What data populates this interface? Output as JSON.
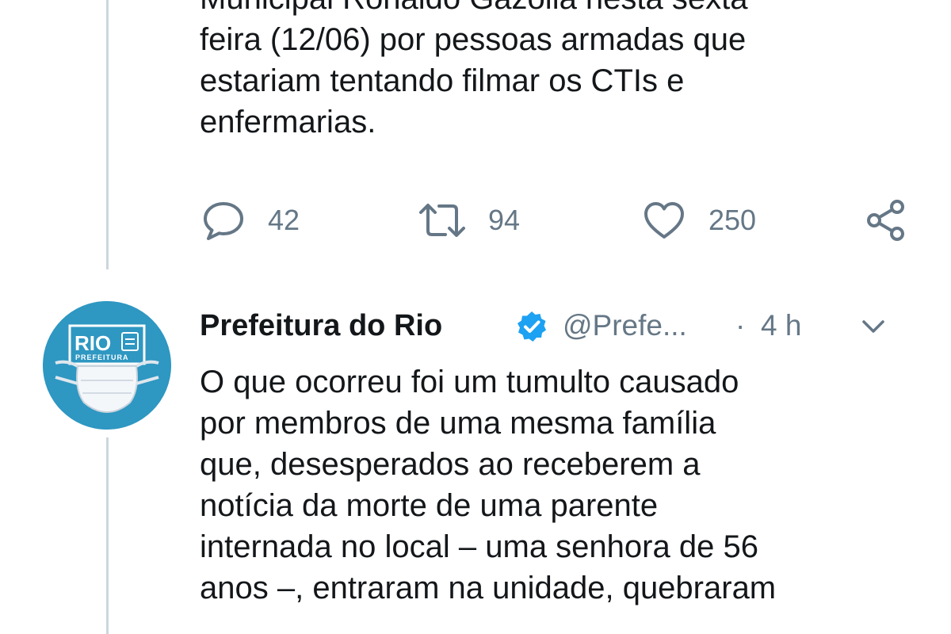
{
  "tweet_above": {
    "text_lines": [
      "Municipal Ronaldo Gazolla nesta sexta",
      "feira (12/06) por pessoas armadas que",
      "estariam tentando filmar os CTIs e",
      "enfermarias."
    ],
    "actions": {
      "replies": "42",
      "retweets": "94",
      "likes": "250"
    }
  },
  "tweet": {
    "author_name": "Prefeitura do Rio",
    "handle": "@Prefe...",
    "separator": "·",
    "time": "4 h",
    "avatar": {
      "text_main": "RIO",
      "text_sub": "PREFEITURA",
      "color": "#2e97c2"
    },
    "text_lines": [
      "O que ocorreu foi um tumulto causado",
      "por membros de uma mesma família",
      "que, desesperados ao receberem a",
      "notícia da morte de uma parente",
      "internada no local – uma senhora de 56",
      "anos –, entraram na unidade, quebraram"
    ]
  },
  "icons": {
    "reply": "reply-icon",
    "retweet": "retweet-icon",
    "like": "heart-icon",
    "share": "share-icon",
    "verified": "verified-badge-icon",
    "more": "chevron-down-icon"
  },
  "colors": {
    "text": "#14171a",
    "secondary": "#657786",
    "verified": "#1da1f2",
    "thread_line": "#ccd6dd"
  }
}
